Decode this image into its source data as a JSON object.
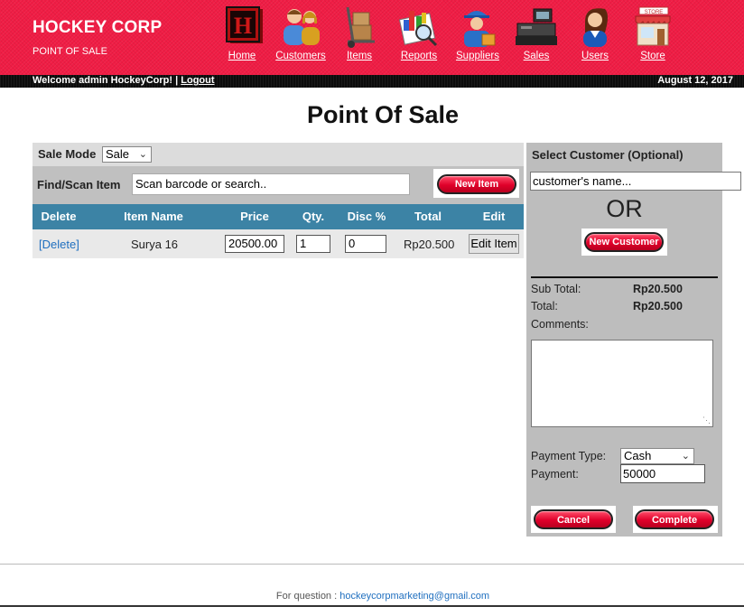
{
  "header": {
    "brand": "HOCKEY CORP",
    "subtitle": "POINT OF SALE",
    "nav": [
      {
        "label": "Home",
        "icon": "home-icon"
      },
      {
        "label": "Customers",
        "icon": "customers-icon"
      },
      {
        "label": "Items",
        "icon": "items-icon"
      },
      {
        "label": "Reports",
        "icon": "reports-icon"
      },
      {
        "label": "Suppliers",
        "icon": "suppliers-icon"
      },
      {
        "label": "Sales",
        "icon": "sales-icon"
      },
      {
        "label": "Users",
        "icon": "users-icon"
      },
      {
        "label": "Store",
        "icon": "store-icon"
      }
    ],
    "store_sign": "STORE",
    "welcome": "Welcome admin HockeyCorp! |",
    "logout": "Logout",
    "date": "August 12, 2017"
  },
  "colors": {
    "header_red": "#f01c44",
    "table_header": "#3c83a5",
    "button_red": "#e0002a",
    "link_blue": "#1f6fbf"
  },
  "page_title": "Point Of Sale",
  "sale_mode": {
    "label": "Sale Mode",
    "value": "Sale"
  },
  "find": {
    "label": "Find/Scan Item",
    "placeholder": "Scan barcode or search..",
    "new_item": "New Item"
  },
  "table": {
    "headers": [
      "Delete",
      "Item Name",
      "Price",
      "Qty.",
      "Disc %",
      "Total",
      "Edit"
    ],
    "rows": [
      {
        "delete": "[Delete]",
        "name": "Surya 16",
        "price": "20500.00",
        "qty": "1",
        "disc": "0",
        "total": "Rp20.500",
        "edit": "Edit Item"
      }
    ]
  },
  "customer": {
    "title": "Select Customer (Optional)",
    "placeholder": "customer's name...",
    "or": "OR",
    "new_customer": "New Customer"
  },
  "summary": {
    "subtotal_label": "Sub Total:",
    "subtotal": "Rp20.500",
    "total_label": "Total:",
    "total": "Rp20.500",
    "comments_label": "Comments:",
    "payment_type_label": "Payment Type:",
    "payment_type": "Cash",
    "payment_label": "Payment:",
    "payment": "50000",
    "cancel": "Cancel",
    "complete": "Complete"
  },
  "footer": {
    "text": "For question :",
    "email": "hockeycorpmarketing@gmail.com"
  }
}
